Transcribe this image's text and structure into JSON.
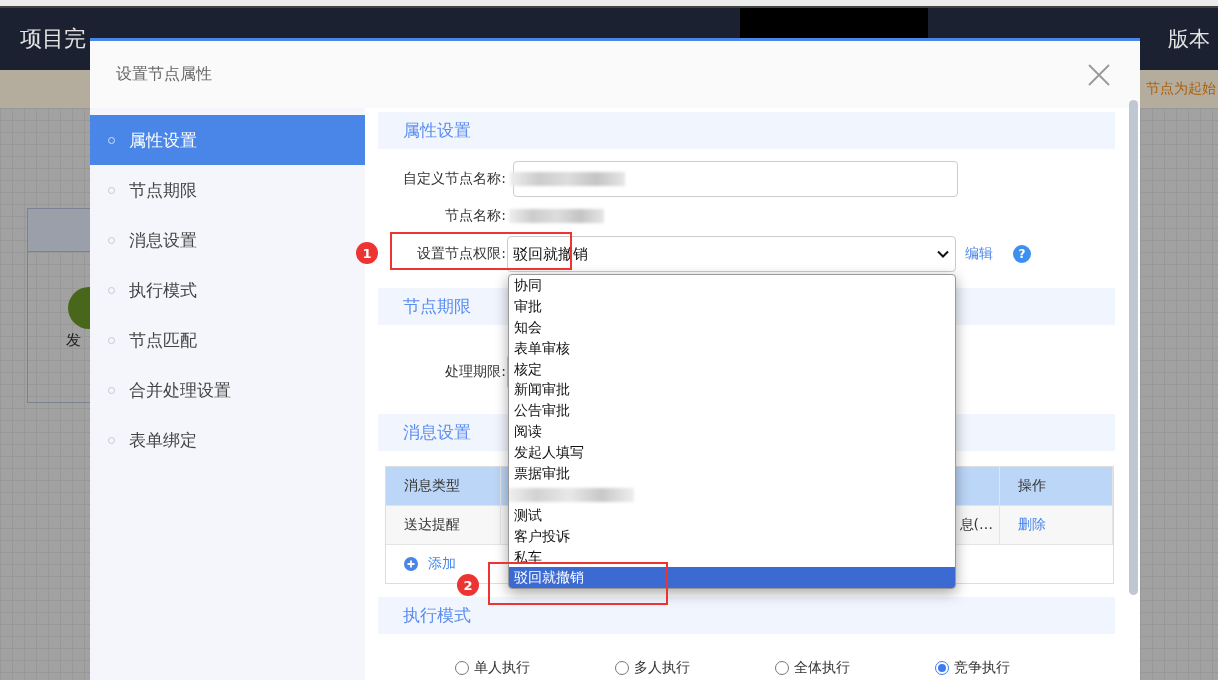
{
  "header": {
    "title": "项目完",
    "menu_tail": "版本",
    "active_tab": true
  },
  "notice": "节点为起始",
  "canvas": {
    "node_label": "发"
  },
  "dialog": {
    "title": "设置节点属性",
    "sidebar": [
      {
        "label": "属性设置",
        "selected": true
      },
      {
        "label": "节点期限",
        "selected": false
      },
      {
        "label": "消息设置",
        "selected": false
      },
      {
        "label": "执行模式",
        "selected": false
      },
      {
        "label": "节点匹配",
        "selected": false
      },
      {
        "label": "合并处理设置",
        "selected": false
      },
      {
        "label": "表单绑定",
        "selected": false
      }
    ],
    "sections": [
      {
        "kind": "properties",
        "title": "属性设置",
        "custom_name_label": "自定义节点名称:",
        "node_name_label": "节点名称:",
        "permission_label": "设置节点权限:",
        "permission_value": "驳回就撤销",
        "edit_link": "编辑",
        "help": "?"
      },
      {
        "kind": "deadline",
        "title": "节点期限",
        "deadline_label": "处理期限:"
      },
      {
        "kind": "messages",
        "title": "消息设置",
        "columns": [
          "消息类型",
          "操作"
        ],
        "rows": [
          {
            "type": "送达提醒",
            "content": "息(…",
            "action": "删除"
          }
        ],
        "add": "添加"
      },
      {
        "kind": "mode",
        "title": "执行模式",
        "options": [
          {
            "label": "单人执行",
            "selected": false
          },
          {
            "label": "多人执行",
            "selected": false
          },
          {
            "label": "全体执行",
            "selected": false
          },
          {
            "label": "竞争执行",
            "selected": true
          }
        ]
      }
    ],
    "dropdown": [
      {
        "kind": "option",
        "label": "协同",
        "selected": false
      },
      {
        "kind": "option",
        "label": "审批",
        "selected": false
      },
      {
        "kind": "option",
        "label": "知会",
        "selected": false
      },
      {
        "kind": "option",
        "label": "表单审核",
        "selected": false
      },
      {
        "kind": "option",
        "label": "核定",
        "selected": false
      },
      {
        "kind": "option",
        "label": "新闻审批",
        "selected": false
      },
      {
        "kind": "option",
        "label": "公告审批",
        "selected": false
      },
      {
        "kind": "option",
        "label": "阅读",
        "selected": false
      },
      {
        "kind": "option",
        "label": "发起人填写",
        "selected": false
      },
      {
        "kind": "option",
        "label": "票据审批",
        "selected": false
      },
      {
        "kind": "blurred",
        "selected": false
      },
      {
        "kind": "option",
        "label": "测试",
        "selected": false
      },
      {
        "kind": "option",
        "label": "客户投诉",
        "selected": false
      },
      {
        "kind": "option",
        "label": "私车",
        "selected": false
      },
      {
        "kind": "option",
        "label": "驳回就撤销",
        "selected": true
      }
    ]
  },
  "annotations": [
    {
      "number": "1"
    },
    {
      "number": "2"
    }
  ]
}
